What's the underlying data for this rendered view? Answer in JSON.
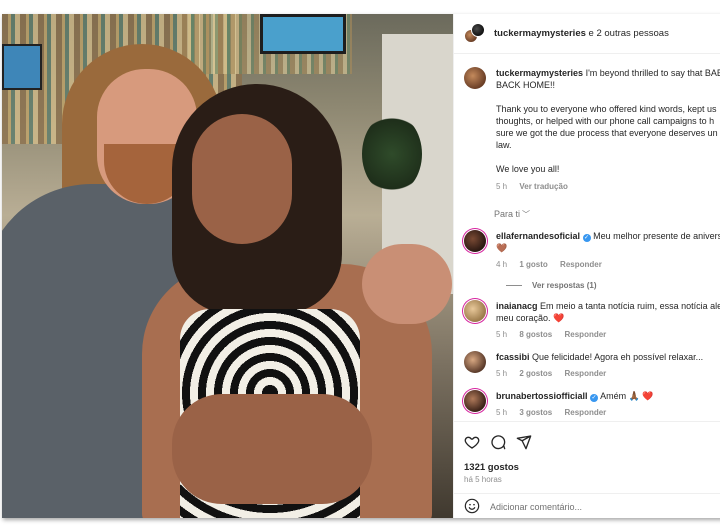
{
  "header": {
    "username": "tuckermaymysteries",
    "others": " e 2 outras pessoas"
  },
  "caption": {
    "username": "tuckermaymysteries",
    "line1": " I'm beyond thrilled to say that BAE",
    "line2": "BACK HOME!!",
    "para2_lines": [
      "Thank you to everyone who offered kind words, kept us",
      "thoughts, or helped with our phone call campaigns to h",
      "sure we got the due process that everyone deserves un",
      "law."
    ],
    "para3": "We love you all!",
    "time": "5 h",
    "translate": "Ver tradução"
  },
  "para_ti": "Para ti",
  "comments": [
    {
      "username": "ellafernandesoficial",
      "verified": true,
      "line1": "Meu melhor presente de anivers",
      "line2": "🤎",
      "time": "4 h",
      "likes": "1 gosto",
      "reply": "Responder"
    },
    {
      "username": "inaianacg",
      "verified": false,
      "line1": " Em meio a tanta notícia ruim, essa notícia ale",
      "line2": "meu coração. ❤️",
      "time": "5 h",
      "likes": "8 gostos",
      "reply": "Responder"
    },
    {
      "username": "fcassibi",
      "verified": false,
      "line1": " Que felicidade! Agora eh possível relaxar...",
      "line2": "",
      "time": "5 h",
      "likes": "2 gostos",
      "reply": "Responder"
    },
    {
      "username": "brunabertossiofficiall",
      "verified": true,
      "line1": "Amém 🙏🏾 ❤️",
      "line2": "",
      "time": "5 h",
      "likes": "3 gostos",
      "reply": "Responder"
    }
  ],
  "view_replies": "Ver respostas (1)",
  "likes_count": "1321 gostos",
  "post_time": "há 5 horas",
  "add_comment_placeholder": "Adicionar comentário...",
  "colors": {
    "verified": "#3897f0",
    "meta": "#8e8e8e",
    "text": "#262626"
  }
}
